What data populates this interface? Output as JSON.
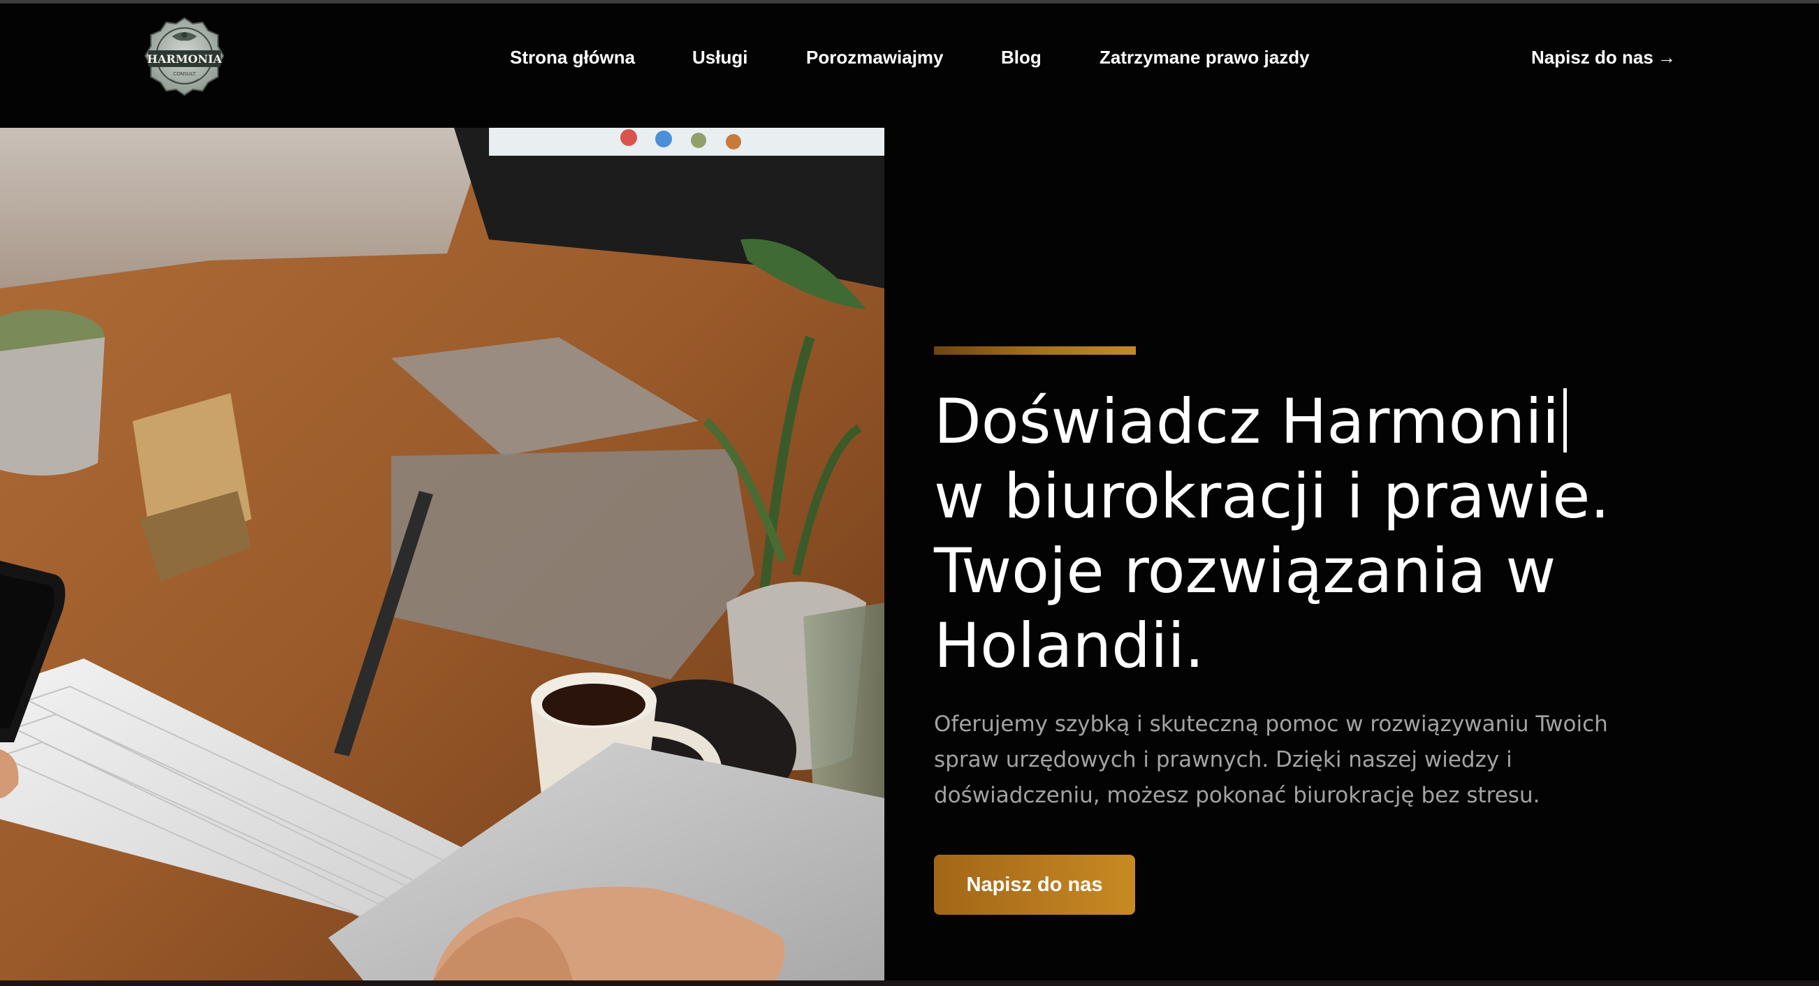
{
  "header": {
    "logo": {
      "icon": "harmonia-consult-logo-icon",
      "text_main": "HARMONIA",
      "text_sub": "CONSULT"
    },
    "nav": [
      {
        "label": "Strona główna"
      },
      {
        "label": "Usługi"
      },
      {
        "label": "Porozmawiajmy"
      },
      {
        "label": "Blog"
      },
      {
        "label": "Zatrzymane prawo jazdy"
      }
    ],
    "cta": {
      "label": "Napisz do nas",
      "arrow": "→"
    }
  },
  "hero": {
    "image": {
      "icon": "desk-workspace-photo"
    },
    "headline": [
      "Doświadcz Harmonii",
      "w biurokracji i prawie.",
      "Twoje rozwiązania w",
      "Holandii."
    ],
    "subtext": [
      "Oferujemy szybką i skuteczną pomoc w rozwiązywaniu Twoich",
      "spraw urzędowych i prawnych. Dzięki naszej wiedzy i",
      "doświadczeniu, możesz pokonać biurokrację bez stresu."
    ],
    "button": {
      "label": "Napisz do nas"
    }
  },
  "colors": {
    "background": "#030303",
    "accent_gold": "#c38a2a",
    "text": "#ffffff",
    "muted_text": "#a3a3a3"
  }
}
